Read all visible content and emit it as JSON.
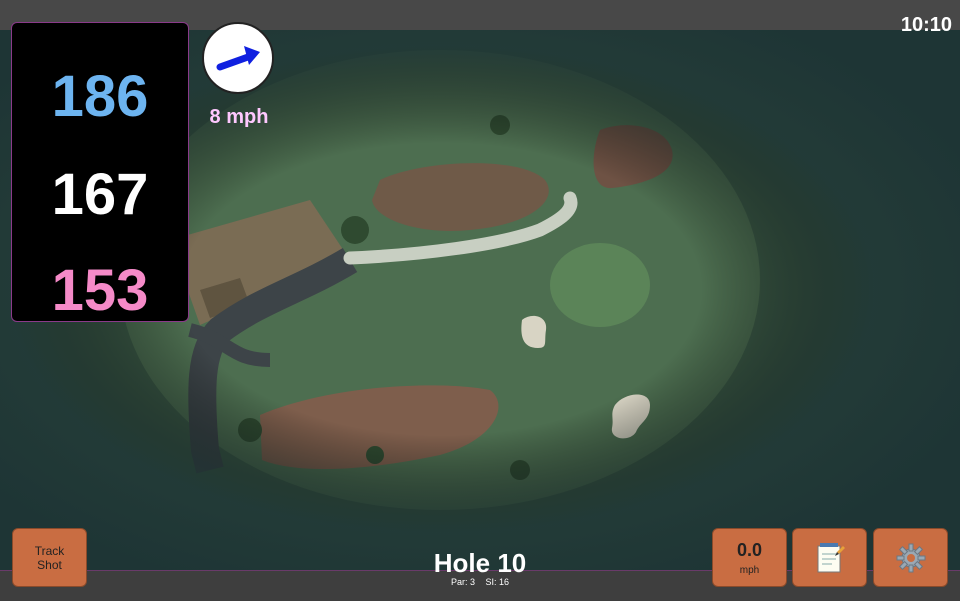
{
  "status": {
    "time": "10:10"
  },
  "distances": {
    "back": "186",
    "center": "167",
    "front": "153"
  },
  "wind": {
    "speed_label": "8 mph",
    "direction_icon": "wind-arrow-icon"
  },
  "hole": {
    "title": "Hole 10",
    "par": "Par: 3",
    "si": "SI: 16"
  },
  "buttons": {
    "track_shot_line1": "Track",
    "track_shot_line2": "Shot",
    "speed_value": "0.0",
    "speed_unit": "mph",
    "notes_icon": "notepad-icon",
    "settings_icon": "gear-icon"
  },
  "colors": {
    "back": "#6db4f0",
    "center": "#ffffff",
    "front": "#f58ac8",
    "button": "#c96d42",
    "wind": "#ffc8ff"
  }
}
